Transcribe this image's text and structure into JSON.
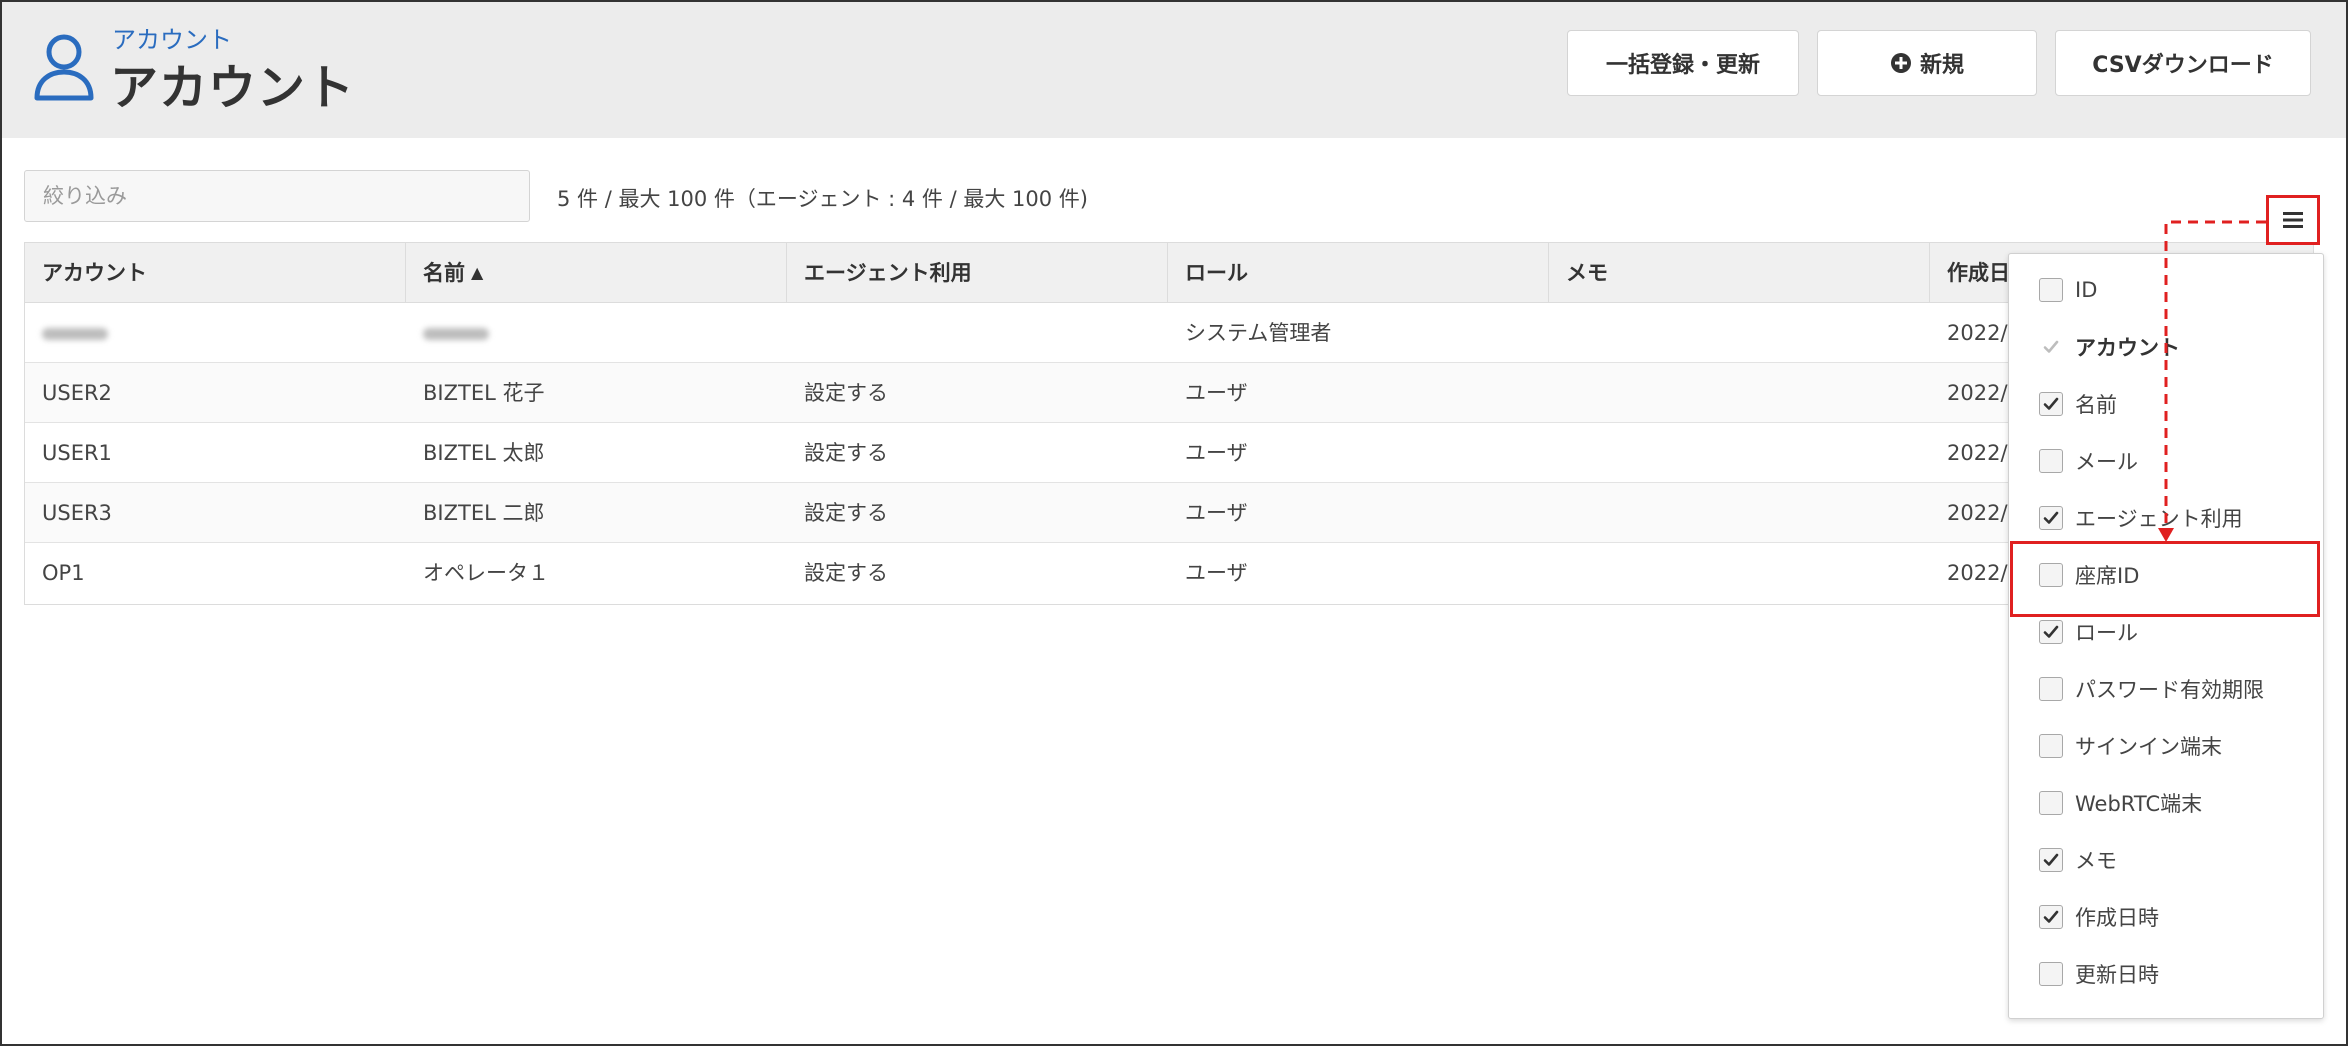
{
  "header": {
    "breadcrumb": "アカウント",
    "title": "アカウント",
    "buttons": {
      "bulk": "一括登録・更新",
      "new": "新規",
      "csv": "CSVダウンロード"
    }
  },
  "filter": {
    "placeholder": "絞り込み",
    "value": "",
    "count_text": "5 件 / 最大 100 件（エージェント : 4 件 / 最大 100 件)"
  },
  "table": {
    "columns": [
      "アカウント",
      "名前",
      "エージェント利用",
      "ロール",
      "メモ",
      "作成日"
    ],
    "sort_indicator": "▲",
    "rows": [
      {
        "account": "",
        "name": "",
        "agent": "",
        "role": "システム管理者",
        "memo": "",
        "created": "2022/"
      },
      {
        "account": "USER2",
        "name": "BIZTEL 花子",
        "agent": "設定する",
        "role": "ユーザ",
        "memo": "",
        "created": "2022/"
      },
      {
        "account": "USER1",
        "name": "BIZTEL 太郎",
        "agent": "設定する",
        "role": "ユーザ",
        "memo": "",
        "created": "2022/"
      },
      {
        "account": "USER3",
        "name": "BIZTEL 二郎",
        "agent": "設定する",
        "role": "ユーザ",
        "memo": "",
        "created": "2022/"
      },
      {
        "account": "OP1",
        "name": "オペレータ１",
        "agent": "設定する",
        "role": "ユーザ",
        "memo": "",
        "created": "2022/"
      }
    ]
  },
  "column_menu": {
    "icon": "menu-icon",
    "options": [
      {
        "label": "ID",
        "checked": false,
        "disabled": false
      },
      {
        "label": "アカウント",
        "checked": true,
        "disabled": true
      },
      {
        "label": "名前",
        "checked": true,
        "disabled": false
      },
      {
        "label": "メール",
        "checked": false,
        "disabled": false
      },
      {
        "label": "エージェント利用",
        "checked": true,
        "disabled": false
      },
      {
        "label": "座席ID",
        "checked": false,
        "disabled": false
      },
      {
        "label": "ロール",
        "checked": true,
        "disabled": false
      },
      {
        "label": "パスワード有効期限",
        "checked": false,
        "disabled": false
      },
      {
        "label": "サインイン端末",
        "checked": false,
        "disabled": false
      },
      {
        "label": "WebRTC端末",
        "checked": false,
        "disabled": false
      },
      {
        "label": "メモ",
        "checked": true,
        "disabled": false
      },
      {
        "label": "作成日時",
        "checked": true,
        "disabled": false
      },
      {
        "label": "更新日時",
        "checked": false,
        "disabled": false
      }
    ]
  },
  "colors": {
    "accent_blue": "#2a6cbf",
    "annotation_red": "#e02020",
    "header_bg": "#ececec"
  }
}
